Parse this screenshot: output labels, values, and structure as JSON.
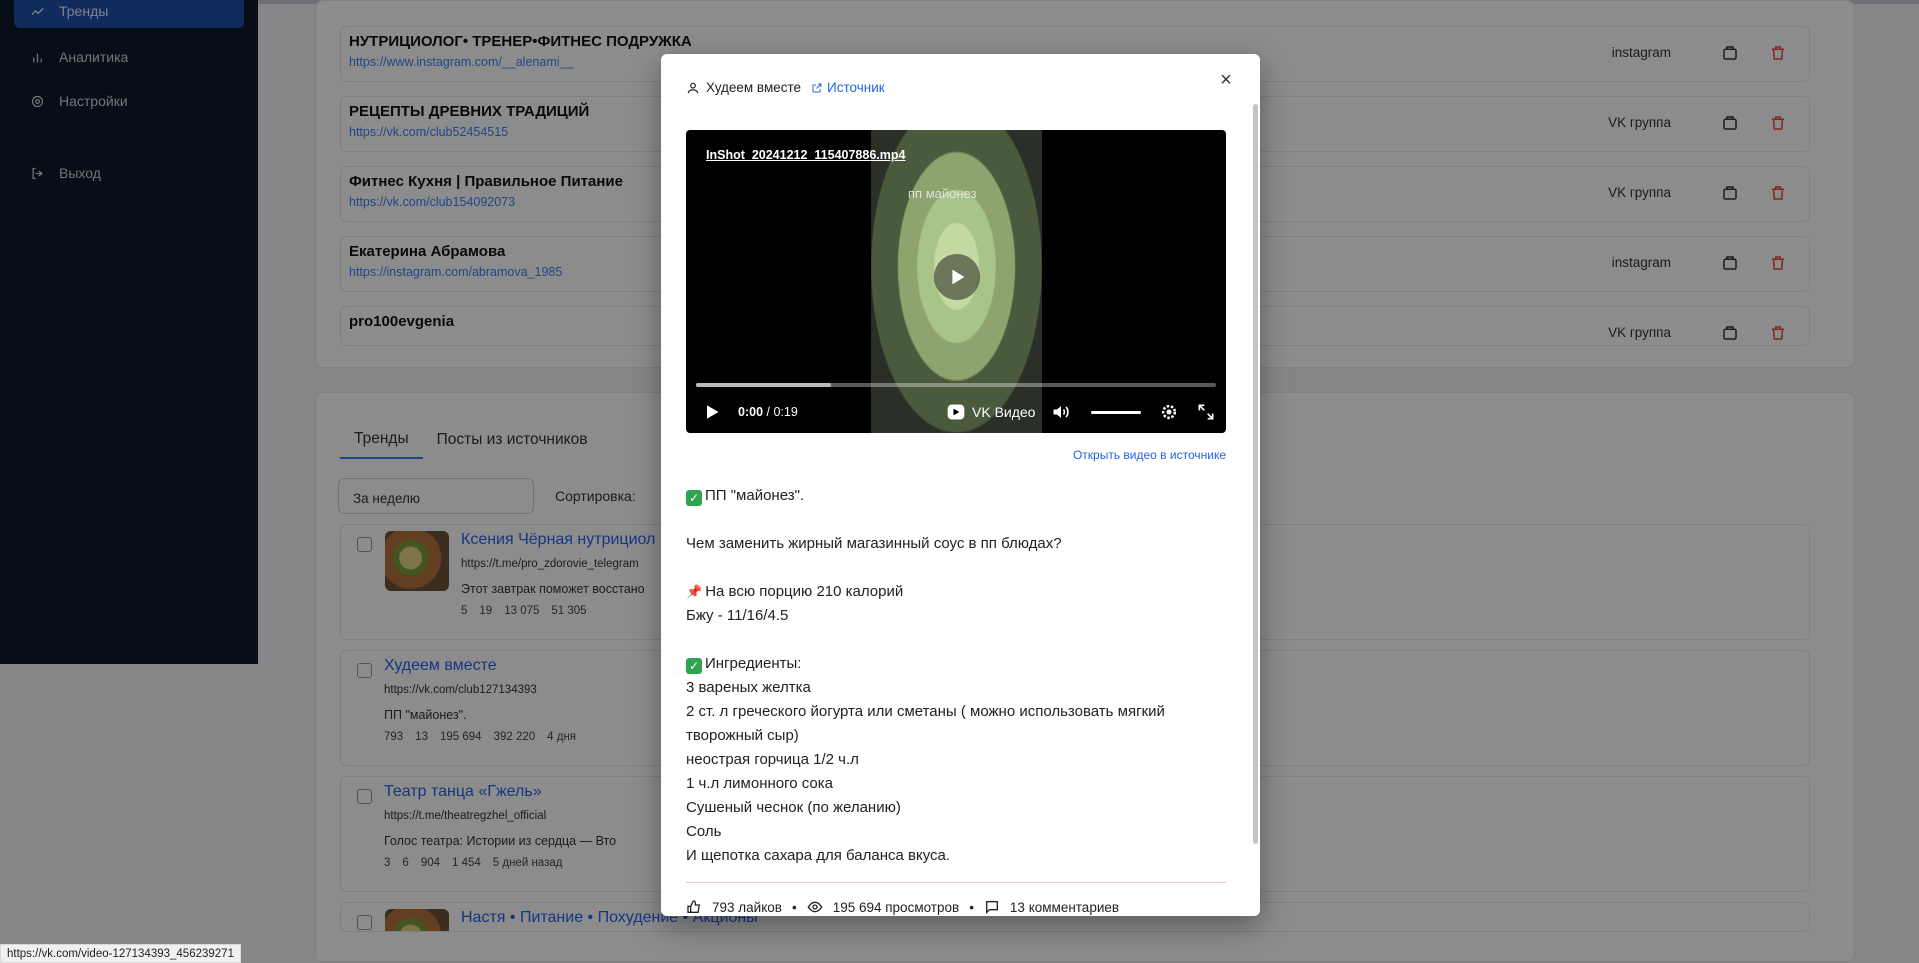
{
  "sidebar": {
    "items": [
      {
        "label": "Тренды",
        "icon": "trend-icon"
      },
      {
        "label": "Аналитика",
        "icon": "bar-chart-icon"
      },
      {
        "label": "Настройки",
        "icon": "gear-icon"
      },
      {
        "label": "Выход",
        "icon": "logout-icon"
      }
    ]
  },
  "sources": [
    {
      "name": "НУТРИЦИОЛОГ• ТРЕНЕР•ФИТНЕС ПОДРУЖКА",
      "url": "https://www.instagram.com/__alenami__",
      "type": "instagram"
    },
    {
      "name": "РЕЦЕПТЫ ДРЕВНИХ ТРАДИЦИЙ",
      "url": "https://vk.com/club52454515",
      "type": "VK группа"
    },
    {
      "name": "Фитнес Кухня | Правильное Питание",
      "url": "https://vk.com/club154092073",
      "type": "VK группа"
    },
    {
      "name": "Екатерина Абрамова",
      "url": "https://instagram.com/abramova_1985",
      "type": "instagram"
    },
    {
      "name": "pro100evgenia",
      "url": "",
      "type": "VK группа"
    }
  ],
  "tabs": [
    {
      "label": "Тренды"
    },
    {
      "label": "Посты из источников"
    }
  ],
  "filters": {
    "period": "За неделю",
    "sort_label": "Сортировка:"
  },
  "posts": [
    {
      "title": "Ксения Чёрная нутрициол",
      "url": "https://t.me/pro_zdorovie_telegram",
      "text": "Этот завтрак поможет восстано",
      "stats": [
        "5",
        "19",
        "13 075",
        "51 305"
      ]
    },
    {
      "title": "Худеем вместе",
      "url": "https://vk.com/club127134393",
      "text": "ПП \"майонез\".",
      "stats": [
        "793",
        "13",
        "195 694",
        "392 220",
        "4 дня"
      ]
    },
    {
      "title": "Театр танца «Гжель»",
      "url": "https://t.me/theatregzhel_official",
      "text": "Голос театра: Истории из сердца — Вто",
      "stats": [
        "3",
        "6",
        "904",
        "1 454",
        "5 дней назад"
      ]
    },
    {
      "title": "Настя • Питание • Похудение • Акционы",
      "url": "",
      "text": "",
      "stats": []
    }
  ],
  "status_url": "https://vk.com/video-127134393_456239271",
  "modal": {
    "author": "Худеем вместе",
    "source_link": "Источник",
    "video": {
      "filename": "InShot_20241212_115407886.mp4",
      "overlay_text": "пп майонез",
      "current_time": "0:00",
      "duration": "0:19",
      "brand": "VK Видео",
      "progress_pct": 26
    },
    "open_source_link": "Открыть видео в источнике",
    "text_lines": [
      {
        "emoji": "check",
        "text": "ПП \"майонез\"."
      },
      {
        "emoji": "",
        "text": ""
      },
      {
        "emoji": "",
        "text": "Чем заменить жирный магазинный соус в пп блюдах?"
      },
      {
        "emoji": "",
        "text": ""
      },
      {
        "emoji": "pin",
        "text": "На всю порцию 210 калорий"
      },
      {
        "emoji": "",
        "text": "Бжу - 11/16/4.5"
      },
      {
        "emoji": "",
        "text": ""
      },
      {
        "emoji": "check",
        "text": "Ингредиенты:"
      },
      {
        "emoji": "",
        "text": "3 вареных желтка"
      },
      {
        "emoji": "",
        "text": "2 ст. л греческого йогурта или сметаны ( можно использовать мягкий творожный сыр)"
      },
      {
        "emoji": "",
        "text": "неострая горчица 1/2 ч.л"
      },
      {
        "emoji": "",
        "text": "1 ч.л лимонного сока"
      },
      {
        "emoji": "",
        "text": "Сушеный чеснок (по желанию)"
      },
      {
        "emoji": "",
        "text": "Соль"
      },
      {
        "emoji": "",
        "text": "И щепотка сахара для баланса вкуса."
      }
    ],
    "stats": {
      "likes": "793 лайков",
      "views": "195 694 просмотров",
      "comments": "13 комментариев"
    }
  },
  "colors": {
    "accent": "#2563eb",
    "sidebar_bg": "#0f1b2d",
    "danger": "#ef4444"
  }
}
